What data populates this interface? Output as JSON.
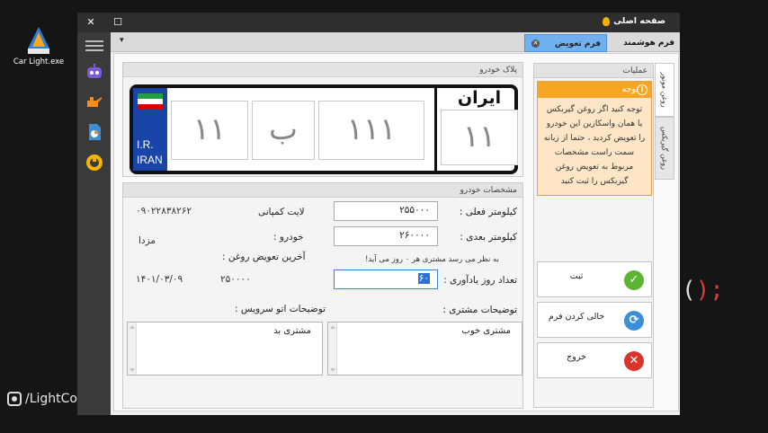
{
  "desktop": {
    "icon_label": "Car Light.exe",
    "brand": "/LightCo"
  },
  "background_code": {
    "paren": "(",
    "close": ");"
  },
  "window": {
    "title": "صفحه اصلی",
    "close_glyph": "✕",
    "maximize_glyph": "☐"
  },
  "tabs": {
    "main": "فرم هوشمند",
    "active": "فرم تعویض روغن",
    "close_glyph": "✕",
    "dropdown_glyph": "▾"
  },
  "plate_section": {
    "header": "پلاک خودرو",
    "country_line1": "I.R.",
    "country_line2": "IRAN",
    "first_number": "۱۱",
    "letter": "ب",
    "middle_number": "۱۱۱",
    "region_label": "ایران",
    "region_number": "۱۱"
  },
  "vehicle_section": {
    "header": "مشخصات خودرو",
    "current_km_label": "کیلومتر فعلی :",
    "current_km_value": "۲۵۵۰۰۰",
    "next_km_label": "کیلومتر بعدی :",
    "next_km_value": "۲۶۰۰۰۰",
    "reminder_label": "تعداد روز یادآوری :",
    "reminder_value": "۶۰",
    "hint": "به نظر می رسد مشتری هر ۰ روز می آید!",
    "customer_name": "لایت کمپانی",
    "customer_phone": "۰۹۰۲۲۸۳۸۲۶۲",
    "car_label": "خودرو :",
    "car_value": "مزدا",
    "last_change_label": "آخرین تعویض روغن :",
    "last_change_km": "۲۵۰۰۰۰",
    "last_change_date": "۱۴۰۱/۰۳/۰۹",
    "customer_notes_label": "توضیحات مشتری :",
    "customer_notes_value": "مشتری خوب",
    "service_notes_label": "توضیحات اتو سرویس :",
    "service_notes_value": "مشتری بد"
  },
  "operations": {
    "header": "عملیات",
    "warning_title": "توجه",
    "warning_text": "توجه کنید اگر روغن گیربکس یا همان واسکازین این خودرو را تعویض کردید ، حتما از زبانه سمت راست مشخصات مربوط به تعویض روغن گیربکس را ثبت کنید",
    "save_label": "ثبت",
    "clear_label": "خالی کردن فرم",
    "exit_label": "خروج"
  },
  "side_tabs": {
    "engine_oil": "روغن موتور",
    "gearbox_oil": "روغن گیربکس"
  },
  "colors": {
    "accent": "#6fb0f0",
    "warning": "#f6a623",
    "save": "#5cb531",
    "exit": "#d9342b",
    "refresh": "#3b8fd6"
  }
}
